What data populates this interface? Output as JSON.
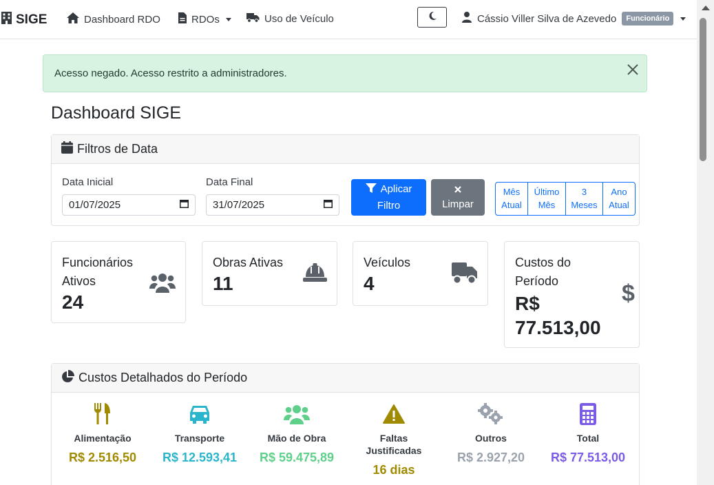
{
  "navbar": {
    "brand": "SIGE",
    "links": [
      {
        "label": "Dashboard RDO",
        "icon": "home-icon"
      },
      {
        "label": "RDOs",
        "icon": "file-icon"
      },
      {
        "label": "Uso de Veículo",
        "icon": "truck-icon"
      }
    ],
    "theme_toggle_icon": "moon-icon",
    "user": {
      "name": "Cássio Viller Silva de Azevedo",
      "role": "Funcionário"
    }
  },
  "alert": {
    "message": "Acesso negado. Acesso restrito a administradores."
  },
  "page_title": "Dashboard SIGE",
  "filters": {
    "title": "Filtros de Data",
    "start_label": "Data Inicial",
    "start_value": "01/07/2025",
    "end_label": "Data Final",
    "end_value": "31/07/2025",
    "apply": {
      "line1": "Aplicar",
      "line2": "Filtro"
    },
    "clear": {
      "line1": "",
      "line2": "Limpar"
    },
    "presets": [
      {
        "line1": "Mês",
        "line2": "Atual"
      },
      {
        "line1": "Último",
        "line2": "Mês"
      },
      {
        "line1": "3",
        "line2": "Meses"
      },
      {
        "line1": "Ano",
        "line2": "Atual"
      }
    ]
  },
  "stats": [
    {
      "label_line1": "Funcionários",
      "label_line2": "Ativos",
      "value": "24",
      "icon": "users-icon"
    },
    {
      "label_line1": "Obras Ativas",
      "label_line2": "",
      "value": "11",
      "icon": "hard-hat-icon"
    },
    {
      "label_line1": "Veículos",
      "label_line2": "",
      "value": "4",
      "icon": "truck-icon"
    },
    {
      "label_line1": "Custos do",
      "label_line2": "Período",
      "value_line1": "R$",
      "value_line2": "77.513,00",
      "icon": "dollar-icon"
    }
  ],
  "costs": {
    "title": "Custos Detalhados do Período",
    "items": [
      {
        "label": "Alimentação",
        "value": "R$ 2.516,50",
        "color": "#a08a00",
        "icon": "utensils-icon"
      },
      {
        "label": "Transporte",
        "value": "R$ 12.593,41",
        "color": "#2bb5cc",
        "icon": "car-icon"
      },
      {
        "label": "Mão de Obra",
        "value": "R$ 59.475,89",
        "color": "#5fd08a",
        "icon": "users-icon"
      },
      {
        "label_line1": "Faltas",
        "label_line2": "Justificadas",
        "value": "16 dias",
        "color": "#a08a00",
        "icon": "warning-icon"
      },
      {
        "label": "Outros",
        "value": "R$ 2.927,20",
        "color": "#9aa3ad",
        "icon": "gears-icon"
      },
      {
        "label": "Total",
        "value": "R$ 77.513,00",
        "color": "#7b5be6",
        "icon": "calculator-icon"
      }
    ]
  }
}
